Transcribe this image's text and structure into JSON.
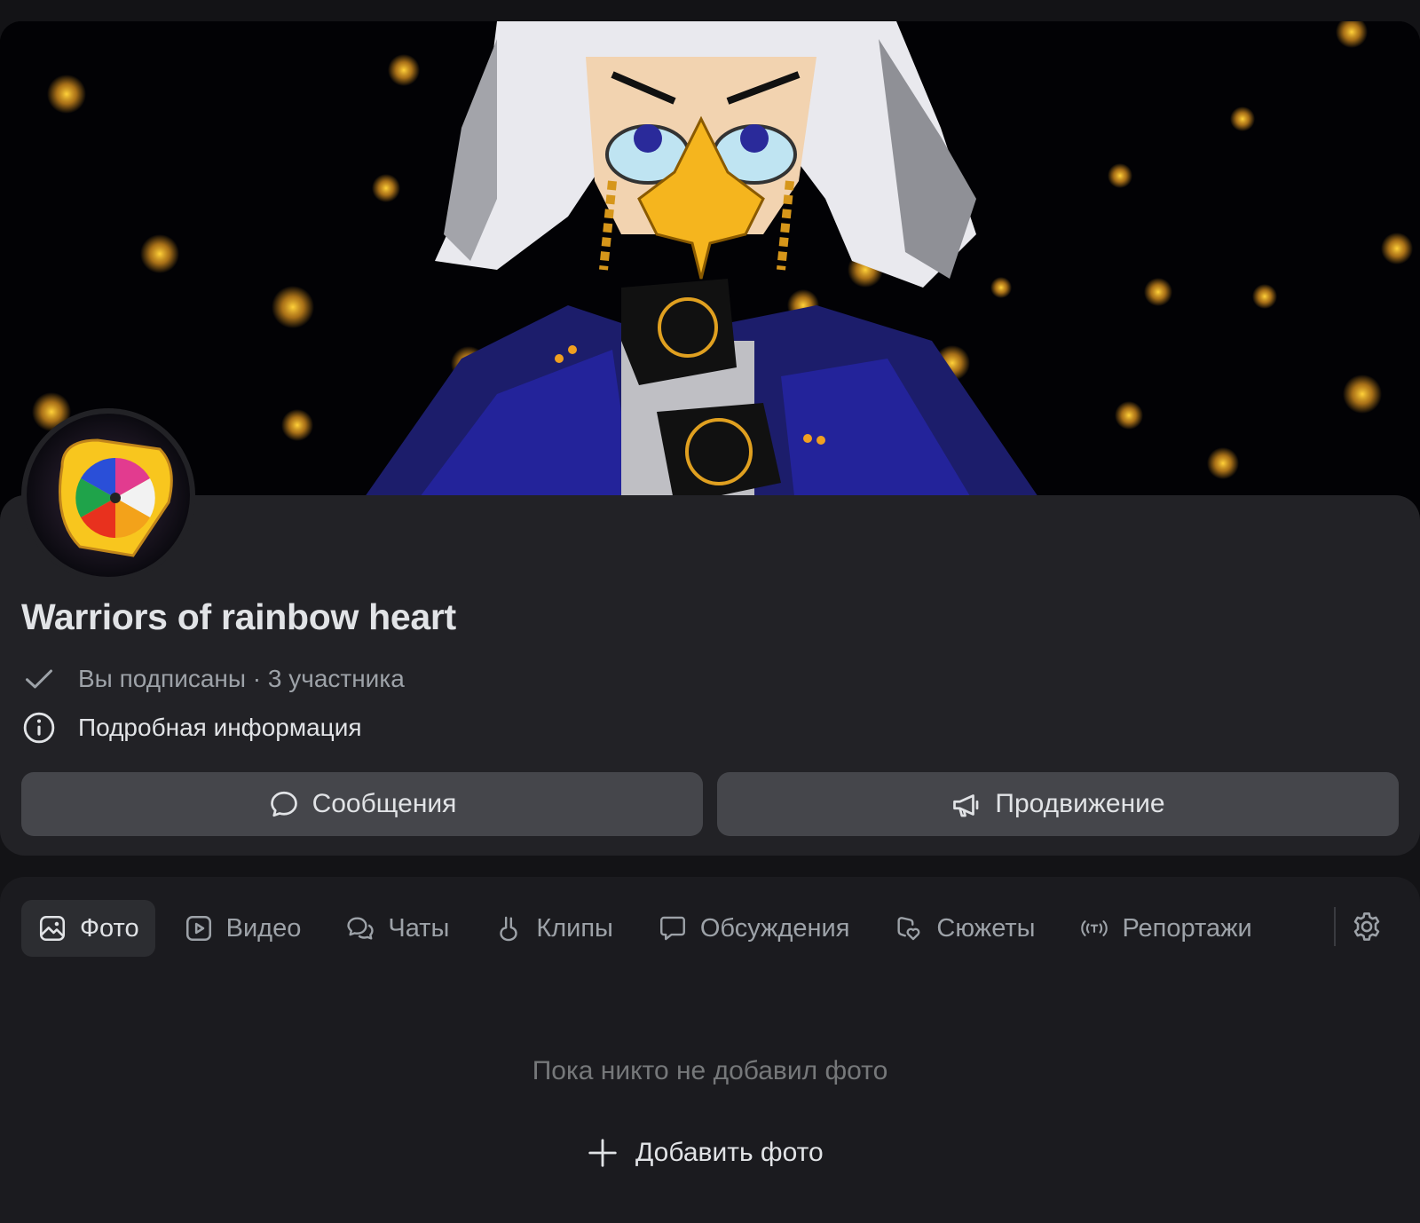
{
  "group": {
    "name": "Warriors of rainbow heart",
    "subscription_status": "Вы подписаны · 3 участника",
    "details_link": "Подробная информация"
  },
  "actions": {
    "messages_label": "Сообщения",
    "promotion_label": "Продвижение"
  },
  "tabs": [
    {
      "label": "Фото",
      "icon": "photo-icon",
      "active": true
    },
    {
      "label": "Видео",
      "icon": "video-icon",
      "active": false
    },
    {
      "label": "Чаты",
      "icon": "chats-icon",
      "active": false
    },
    {
      "label": "Клипы",
      "icon": "clips-icon",
      "active": false
    },
    {
      "label": "Обсуждения",
      "icon": "discussions-icon",
      "active": false
    },
    {
      "label": "Сюжеты",
      "icon": "stories-icon",
      "active": false
    },
    {
      "label": "Репортажи",
      "icon": "broadcast-icon",
      "active": false
    }
  ],
  "photos": {
    "empty_message": "Пока никто не добавил фото",
    "add_label": "Добавить фото"
  },
  "colors": {
    "background": "#131316",
    "card": "#222226",
    "button": "#45464b",
    "text_primary": "#e1e3e6",
    "text_secondary": "#9da2a8"
  }
}
